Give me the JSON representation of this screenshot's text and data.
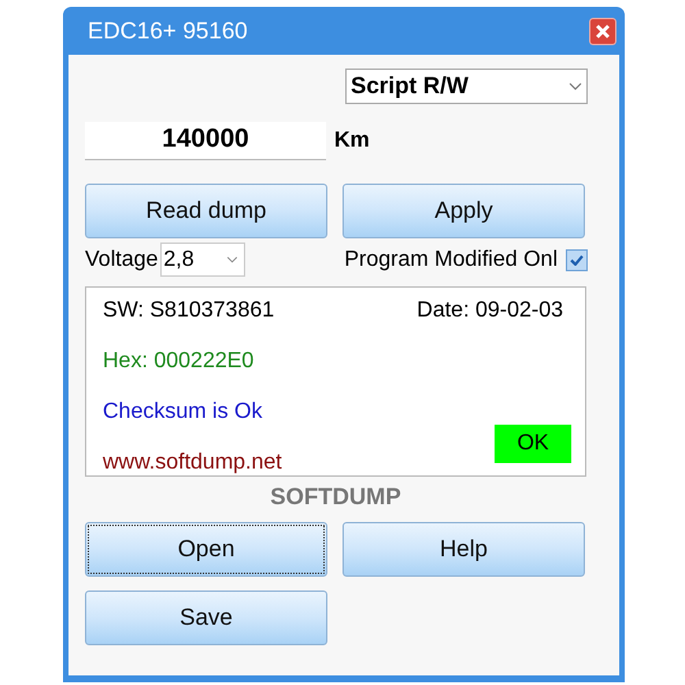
{
  "window": {
    "title": "EDC16+ 95160"
  },
  "mode_select": {
    "value": "Script R/W"
  },
  "mileage": {
    "value": "140000",
    "unit": "Km"
  },
  "top_buttons": [
    {
      "label": "Read dump",
      "focused": false
    },
    {
      "label": "Apply",
      "focused": false
    }
  ],
  "voltage": {
    "label": "Voltage",
    "value": "2,8"
  },
  "program_modified": {
    "label": "Program Modified Onl",
    "checked": true
  },
  "info": {
    "sw": "SW: S810373861",
    "date": "Date: 09-02-03",
    "lines": [
      {
        "text": "Hex: 000222E0",
        "color": "#1e8a1e"
      },
      {
        "text": "Checksum is Ok",
        "color": "#1a1acc"
      },
      {
        "text": "www.softdump.net",
        "color": "#8b1010"
      }
    ],
    "status": {
      "text": "OK",
      "color": "#00ff00"
    }
  },
  "brand": "SOFTDUMP",
  "bottom_buttons": [
    {
      "label": "Open",
      "focused": true
    },
    {
      "label": "Help",
      "focused": false
    },
    {
      "label": "Save",
      "focused": false
    }
  ]
}
